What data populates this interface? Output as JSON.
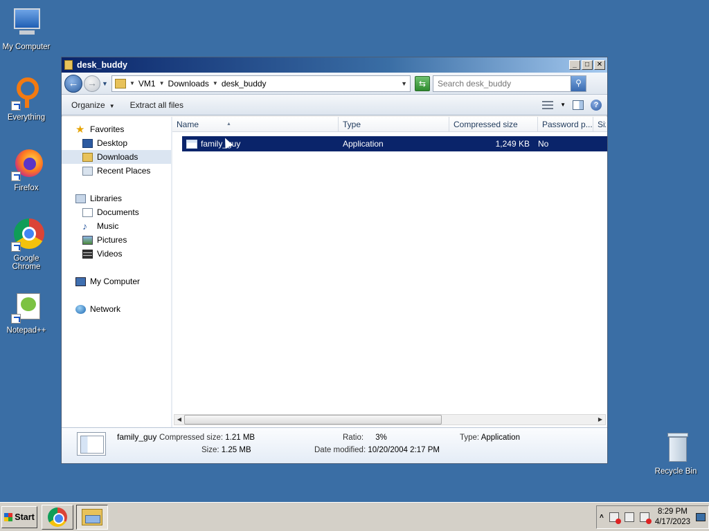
{
  "desktop": {
    "icons": [
      {
        "label": "My Computer"
      },
      {
        "label": "Everything"
      },
      {
        "label": "Firefox"
      },
      {
        "label": "Google Chrome"
      },
      {
        "label": "Notepad++"
      }
    ],
    "recycle_bin": "Recycle Bin"
  },
  "window": {
    "title": "desk_buddy",
    "buttons": {
      "minimize": "_",
      "maximize": "□",
      "close": "✕"
    },
    "breadcrumb": [
      "VM1",
      "Downloads",
      "desk_buddy"
    ],
    "search_placeholder": "Search desk_buddy",
    "toolbar": {
      "organize": "Organize",
      "extract": "Extract all files"
    },
    "nav": {
      "favorites": "Favorites",
      "desktop": "Desktop",
      "downloads": "Downloads",
      "recent": "Recent Places",
      "libraries": "Libraries",
      "documents": "Documents",
      "music": "Music",
      "pictures": "Pictures",
      "videos": "Videos",
      "computer": "My Computer",
      "network": "Network"
    },
    "columns": [
      "Name",
      "Type",
      "Compressed size",
      "Password p...",
      "Siz"
    ],
    "files": [
      {
        "name": "family_guy",
        "type": "Application",
        "compressed_size": "1,249 KB",
        "password": "No"
      }
    ],
    "details": {
      "name": "family_guy",
      "compressed_size_label": "Compressed size:",
      "compressed_size": "1.21 MB",
      "size_label": "Size:",
      "size": "1.25 MB",
      "ratio_label": "Ratio:",
      "ratio": "3%",
      "modified_label": "Date modified:",
      "modified": "10/20/2004 2:17 PM",
      "type_label": "Type:",
      "type": "Application"
    }
  },
  "taskbar": {
    "start": "Start",
    "time": "8:29 PM",
    "date": "4/17/2023"
  }
}
